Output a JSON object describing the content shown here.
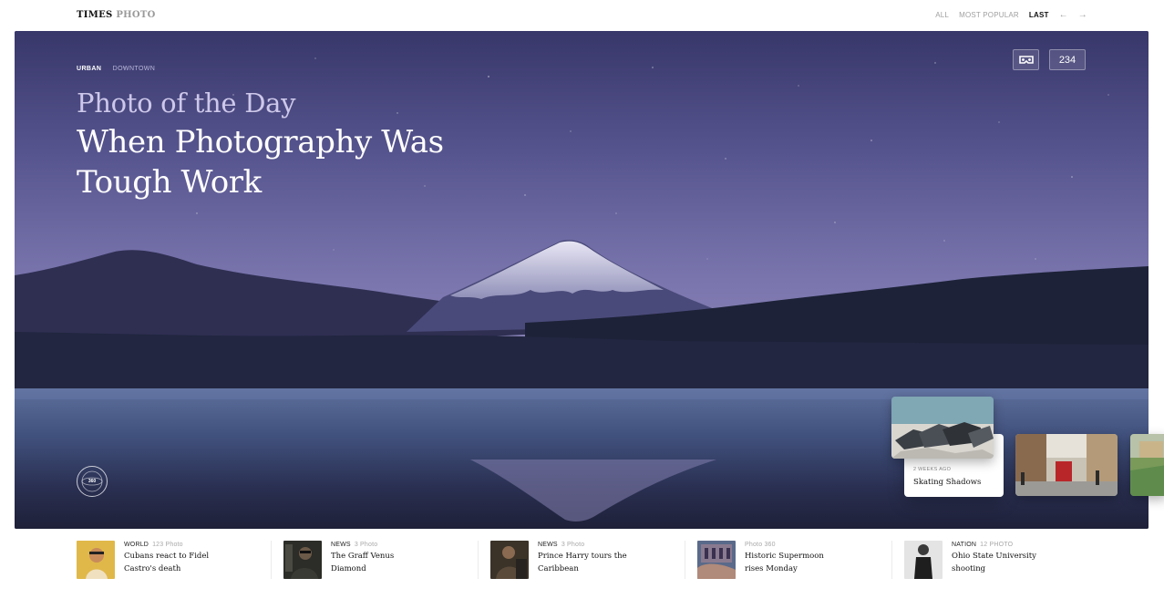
{
  "brand": {
    "part1": "TIMES",
    "part2": "PHOTO"
  },
  "nav": {
    "items": [
      {
        "label": "ALL",
        "active": false
      },
      {
        "label": "MOST POPULAR",
        "active": false
      },
      {
        "label": "LAST",
        "active": true
      }
    ],
    "prev_icon": "arrow-left-icon",
    "next_icon": "arrow-right-icon"
  },
  "hero": {
    "breadcrumb_1": "URBAN",
    "breadcrumb_2": "DOWNTOWN",
    "kicker": "Photo of the Day",
    "title": "When Photography Was Tough Work",
    "vr_icon": "vr-headset-icon",
    "count": "234",
    "pano_label": "360"
  },
  "carousel": {
    "feature": {
      "meta": "2 WEEKS AGO",
      "title": "Skating Shadows"
    }
  },
  "stories": [
    {
      "category": "WORLD",
      "count": "123 Photo",
      "headline": "Cubans react to Fidel Castro's death"
    },
    {
      "category": "NEWS",
      "count": "3 Photo",
      "headline": "The Graff Venus Diamond"
    },
    {
      "category": "NEWS",
      "count": "3 Photo",
      "headline": "Prince Harry tours the Caribbean"
    },
    {
      "category": "Photo 360",
      "count": "",
      "headline": "Historic Supermoon rises Monday"
    },
    {
      "category": "NATION",
      "count": "12 PHOTO",
      "headline": "Ohio State University shooting"
    }
  ],
  "colors": {
    "accent_text": "#111111",
    "muted_text": "#a0a0a0",
    "hero_sky": "#6f6ca3"
  }
}
